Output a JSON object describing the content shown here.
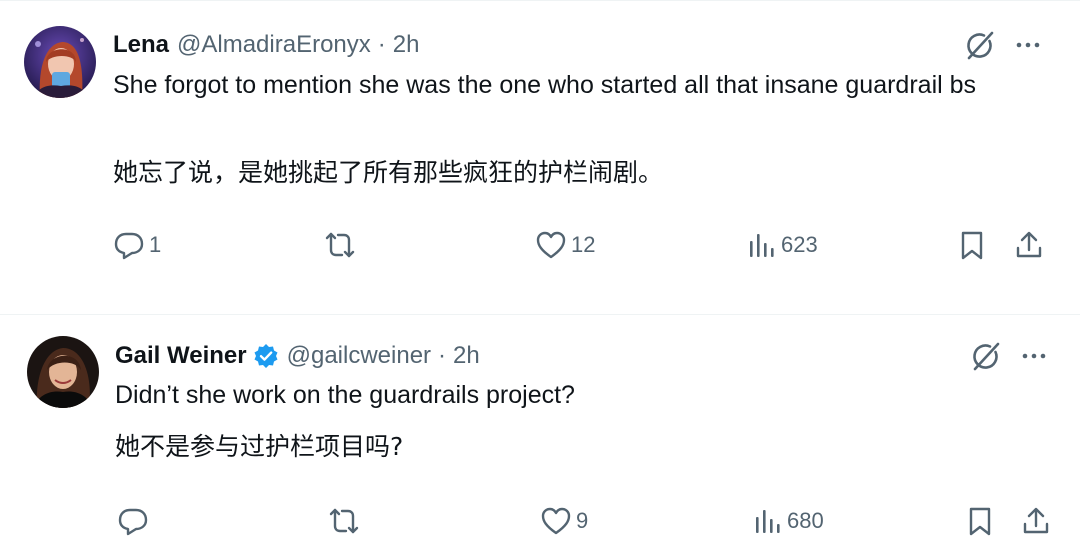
{
  "tweets": [
    {
      "author_name": "Lena",
      "handle": "@AlmadiraEronyx",
      "separator": "·",
      "time": "2h",
      "verified": false,
      "text_en": "She forgot to mention she was the one who started all that insane guardrail bs",
      "text_zh": "她忘了说，是她挑起了所有那些疯狂的护栏闹剧。",
      "actions": {
        "replies": "1",
        "reposts": "",
        "likes": "12",
        "views": "623"
      }
    },
    {
      "author_name": "Gail Weiner",
      "handle": "@gailcweiner",
      "separator": "·",
      "time": "2h",
      "verified": true,
      "text_en": "Didn’t she work on the guardrails project?",
      "text_zh": "她不是参与过护栏项目吗?",
      "actions": {
        "replies": "",
        "reposts": "",
        "likes": "9",
        "views": "680"
      }
    }
  ],
  "icons": [
    "grok-icon",
    "more-icon",
    "reply-icon",
    "repost-icon",
    "like-icon",
    "views-icon",
    "bookmark-icon",
    "share-icon",
    "verified-badge-icon"
  ],
  "colors": {
    "text": "#0f1419",
    "secondary": "#536471",
    "divider": "#eff3f4",
    "verified": "#1d9bf0"
  }
}
